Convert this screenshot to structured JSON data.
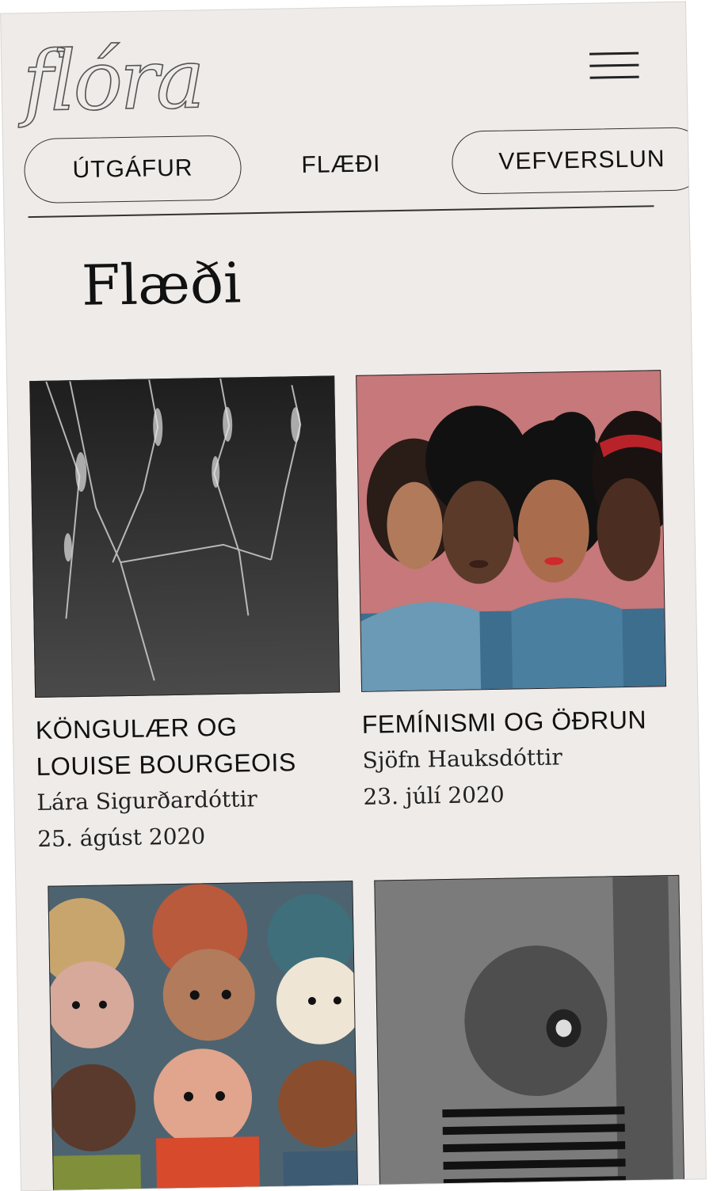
{
  "header": {
    "logo": "flóra",
    "menu_icon": "hamburger-menu-icon"
  },
  "nav": {
    "items": [
      {
        "label": "ÚTGÁFUR"
      },
      {
        "label": "FLÆÐI"
      },
      {
        "label": "VEFVERSLUN"
      }
    ]
  },
  "page": {
    "title": "Flæði"
  },
  "articles": [
    {
      "title_line1": "KÖNGULÆR OG",
      "title_line2": "LOUISE BOURGEOIS",
      "author": "Lára Sigurðardóttir",
      "date": "25. ágúst 2020"
    },
    {
      "title_line1": "FEMÍNISMI OG ÖÐRUN",
      "title_line2": "",
      "author": "Sjöfn Hauksdóttir",
      "date": "23. júlí 2020"
    },
    {
      "title_line1": "",
      "title_line2": "",
      "author": "",
      "date": ""
    },
    {
      "title_line1": "",
      "title_line2": "",
      "author": "",
      "date": ""
    }
  ],
  "colors": {
    "background": "#eeebe9",
    "text": "#111111",
    "pink_bg": "#c6787a"
  }
}
